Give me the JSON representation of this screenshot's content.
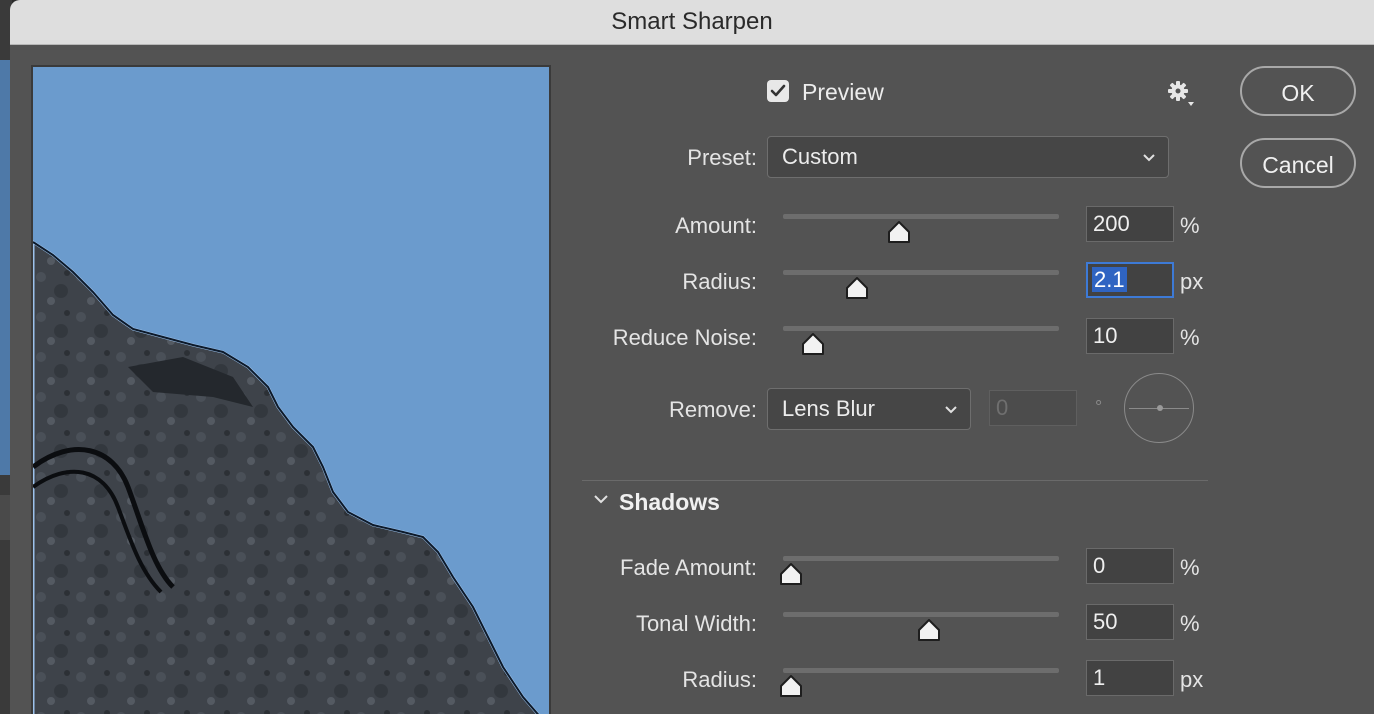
{
  "window": {
    "title": "Smart Sharpen"
  },
  "preview": {
    "label": "Preview",
    "checked": true
  },
  "settings_icon": "gear-icon",
  "buttons": {
    "ok": "OK",
    "cancel": "Cancel"
  },
  "preset": {
    "label": "Preset:",
    "value": "Custom"
  },
  "sliders": {
    "amount": {
      "label": "Amount:",
      "value": "200",
      "unit": "%",
      "level": 0.39
    },
    "radius": {
      "label": "Radius:",
      "value": "2.1",
      "unit": "px",
      "level": 0.24
    },
    "reduce_noise": {
      "label": "Reduce Noise:",
      "value": "10",
      "unit": "%",
      "level": 0.08
    }
  },
  "remove": {
    "label": "Remove:",
    "value": "Lens Blur",
    "angle_value": "0",
    "angle_unit": "°"
  },
  "shadows": {
    "title": "Shadows",
    "fade_amount": {
      "label": "Fade Amount:",
      "value": "0",
      "unit": "%",
      "level": 0.0
    },
    "tonal_width": {
      "label": "Tonal Width:",
      "value": "50",
      "unit": "%",
      "level": 0.5
    },
    "radius": {
      "label": "Radius:",
      "value": "1",
      "unit": "px",
      "level": 0.0
    }
  },
  "colors": {
    "sky": "#6b9bcd",
    "rock": "#3c4147",
    "panel": "#535353",
    "accent": "#2f64c2"
  }
}
